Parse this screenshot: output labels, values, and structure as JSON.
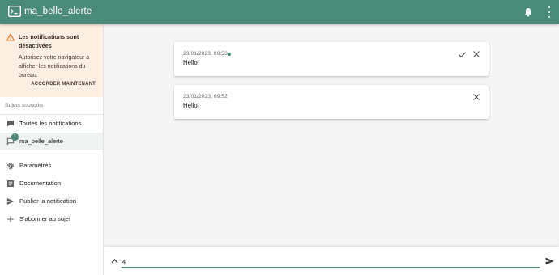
{
  "app": {
    "title": "ma_belle_alerte",
    "accent": "#4a8a78"
  },
  "appbar": {
    "logo_icon": "terminal-icon",
    "bell_icon": "bell-icon",
    "more_icon": "more-vert-icon"
  },
  "warning": {
    "icon": "warning-icon",
    "title": "Les notifications sont désactivées",
    "body": "Autorisez votre navigateur à afficher les notifications du bureau.",
    "action": "ACCORDER MAINTENANT",
    "background": "#fdf0e3"
  },
  "sidebar": {
    "section_label": "Sujets souscrits",
    "subscriptions": [
      {
        "label": "Toutes les notifications",
        "icon": "chat-bubble-icon"
      },
      {
        "label": "ma_belle_alerte",
        "icon": "chat-bubble-outline-icon",
        "badge": "1"
      }
    ],
    "menu": [
      {
        "label": "Paramètres",
        "icon": "settings-icon"
      },
      {
        "label": "Documentation",
        "icon": "article-icon"
      },
      {
        "label": "Publier la notification",
        "icon": "send-icon"
      },
      {
        "label": "S'abonner au sujet",
        "icon": "add-icon"
      }
    ]
  },
  "notifications": [
    {
      "time": "23/01/2023, 09:53",
      "message": "Hello!",
      "new": true
    },
    {
      "time": "23/01/2023, 09:52",
      "message": "Hello!",
      "new": false
    }
  ],
  "message_bar": {
    "value": "4",
    "expand_icon": "chevron-up-icon",
    "send_icon": "send-icon"
  }
}
